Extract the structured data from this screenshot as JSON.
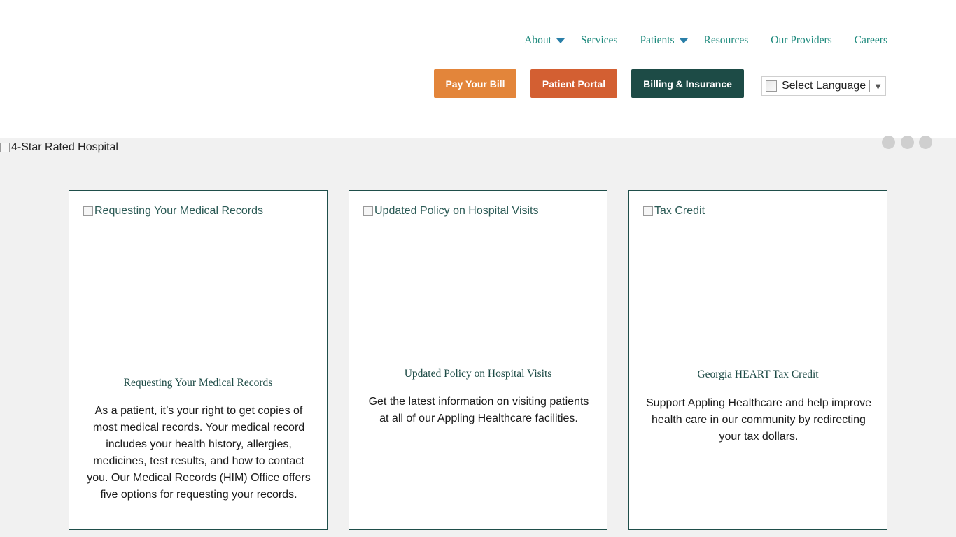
{
  "nav": [
    {
      "label": "About",
      "dropdown": true
    },
    {
      "label": "Services",
      "dropdown": false
    },
    {
      "label": "Patients",
      "dropdown": true
    },
    {
      "label": "Resources",
      "dropdown": false
    },
    {
      "label": "Our Providers",
      "dropdown": false
    },
    {
      "label": "Careers",
      "dropdown": false
    }
  ],
  "buttons": {
    "pay_bill": "Pay Your Bill",
    "patient_portal": "Patient Portal",
    "billing": "Billing & Insurance"
  },
  "language": {
    "label": "Select Language",
    "arrow": "▼"
  },
  "hero": {
    "alt": "4-Star Rated Hospital",
    "slide_count": 3
  },
  "cards": [
    {
      "img_alt": "Requesting Your Medical Records",
      "title": "Requesting Your Medical Records",
      "body": "As a patient, it’s your right to get copies of most medical records. Your medical record includes your health history, allergies, medicines, test results, and how to contact you. Our Medical Records (HIM) Office offers five options for requesting your records."
    },
    {
      "img_alt": "Updated Policy on Hospital Visits",
      "title": "Updated Policy on Hospital Visits",
      "body": "Get the latest information on visiting patients at all of our Appling Healthcare facilities."
    },
    {
      "img_alt": "Tax Credit",
      "title": "Georgia HEART Tax Credit",
      "body": "Support Appling Healthcare and help improve health care in our community by redirecting your tax dollars."
    }
  ],
  "colors": {
    "nav_text": "#1e8a7d",
    "nav_caret": "#2a7fa8",
    "pay_bill": "#e3853a",
    "patient_portal": "#d35f32",
    "billing": "#1d4b46",
    "hero_bg": "#f1f1f1",
    "card_border": "#1f4e4a",
    "card_title": "#1c4a45"
  }
}
